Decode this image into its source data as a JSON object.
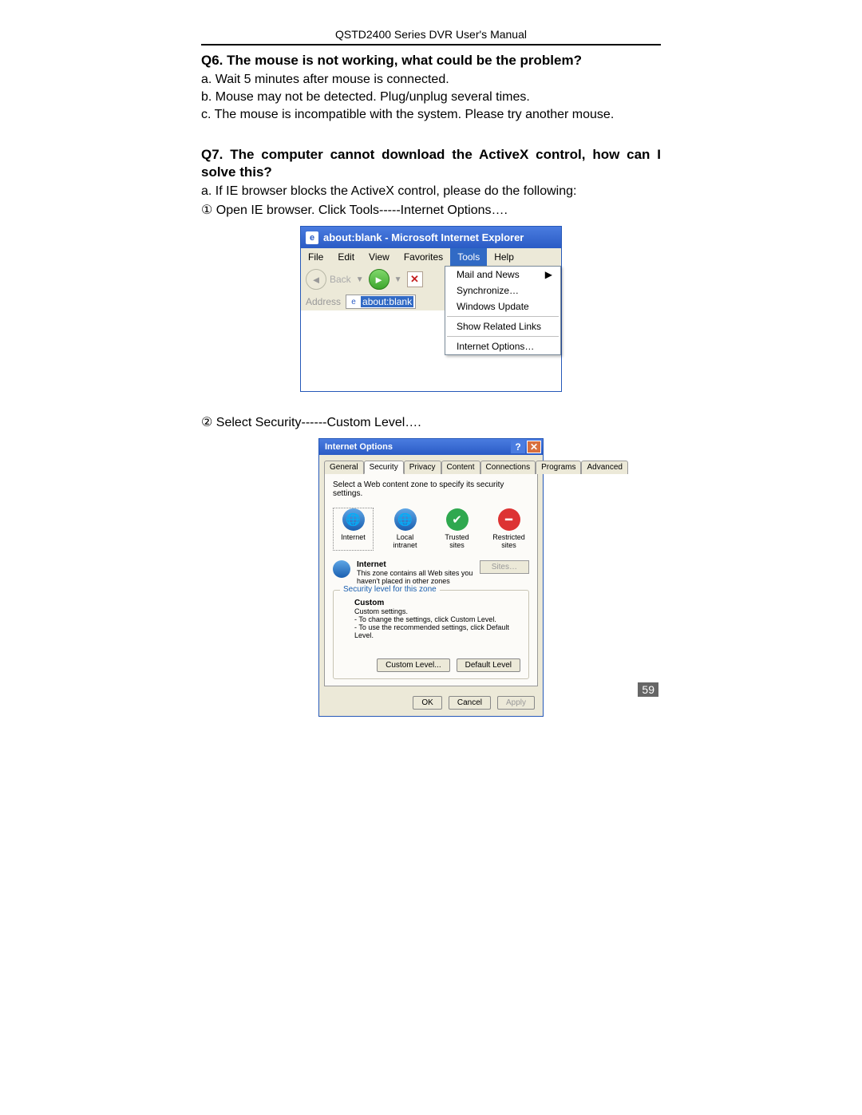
{
  "header": "QSTD2400 Series DVR User's Manual",
  "q6": {
    "title": "Q6. The mouse is not working, what could be the problem?",
    "a": "a. Wait 5 minutes after mouse is connected.",
    "b": "b. Mouse may not be detected. Plug/unplug several times.",
    "c": "c. The mouse is incompatible with the system. Please try another mouse."
  },
  "q7": {
    "title": "Q7. The computer cannot download the ActiveX control, how can I solve this?",
    "a": "a. If IE browser blocks the ActiveX control, please do the following:",
    "step1": "①  Open IE browser. Click Tools-----Internet Options….",
    "step2": "②  Select Security------Custom Level…."
  },
  "ie": {
    "title": "about:blank - Microsoft Internet Explorer",
    "menus": [
      "File",
      "Edit",
      "View",
      "Favorites",
      "Tools",
      "Help"
    ],
    "back": "Back",
    "stop": "✕",
    "address_label": "Address",
    "address_value": "about:blank",
    "dropdown": {
      "mail": "Mail and News",
      "sync": "Synchronize…",
      "upd": "Windows Update",
      "rel": "Show Related Links",
      "opt": "Internet Options…"
    }
  },
  "io": {
    "title": "Internet Options",
    "tabs": [
      "General",
      "Security",
      "Privacy",
      "Content",
      "Connections",
      "Programs",
      "Advanced"
    ],
    "instruct": "Select a Web content zone to specify its security settings.",
    "zones": {
      "internet": "Internet",
      "local": "Local intranet",
      "trusted": "Trusted sites",
      "restricted": "Restricted sites"
    },
    "zone_desc": {
      "title": "Internet",
      "text": "This zone contains all Web sites you haven't placed in other zones",
      "sites": "Sites…"
    },
    "legend": "Security level for this zone",
    "custom": {
      "title": "Custom",
      "l1": "Custom settings.",
      "l2": "- To change the settings, click Custom Level.",
      "l3": "- To use the recommended settings, click Default Level."
    },
    "btns": {
      "custom_level": "Custom Level...",
      "default_level": "Default Level",
      "ok": "OK",
      "cancel": "Cancel",
      "apply": "Apply"
    }
  },
  "page_num": "59"
}
